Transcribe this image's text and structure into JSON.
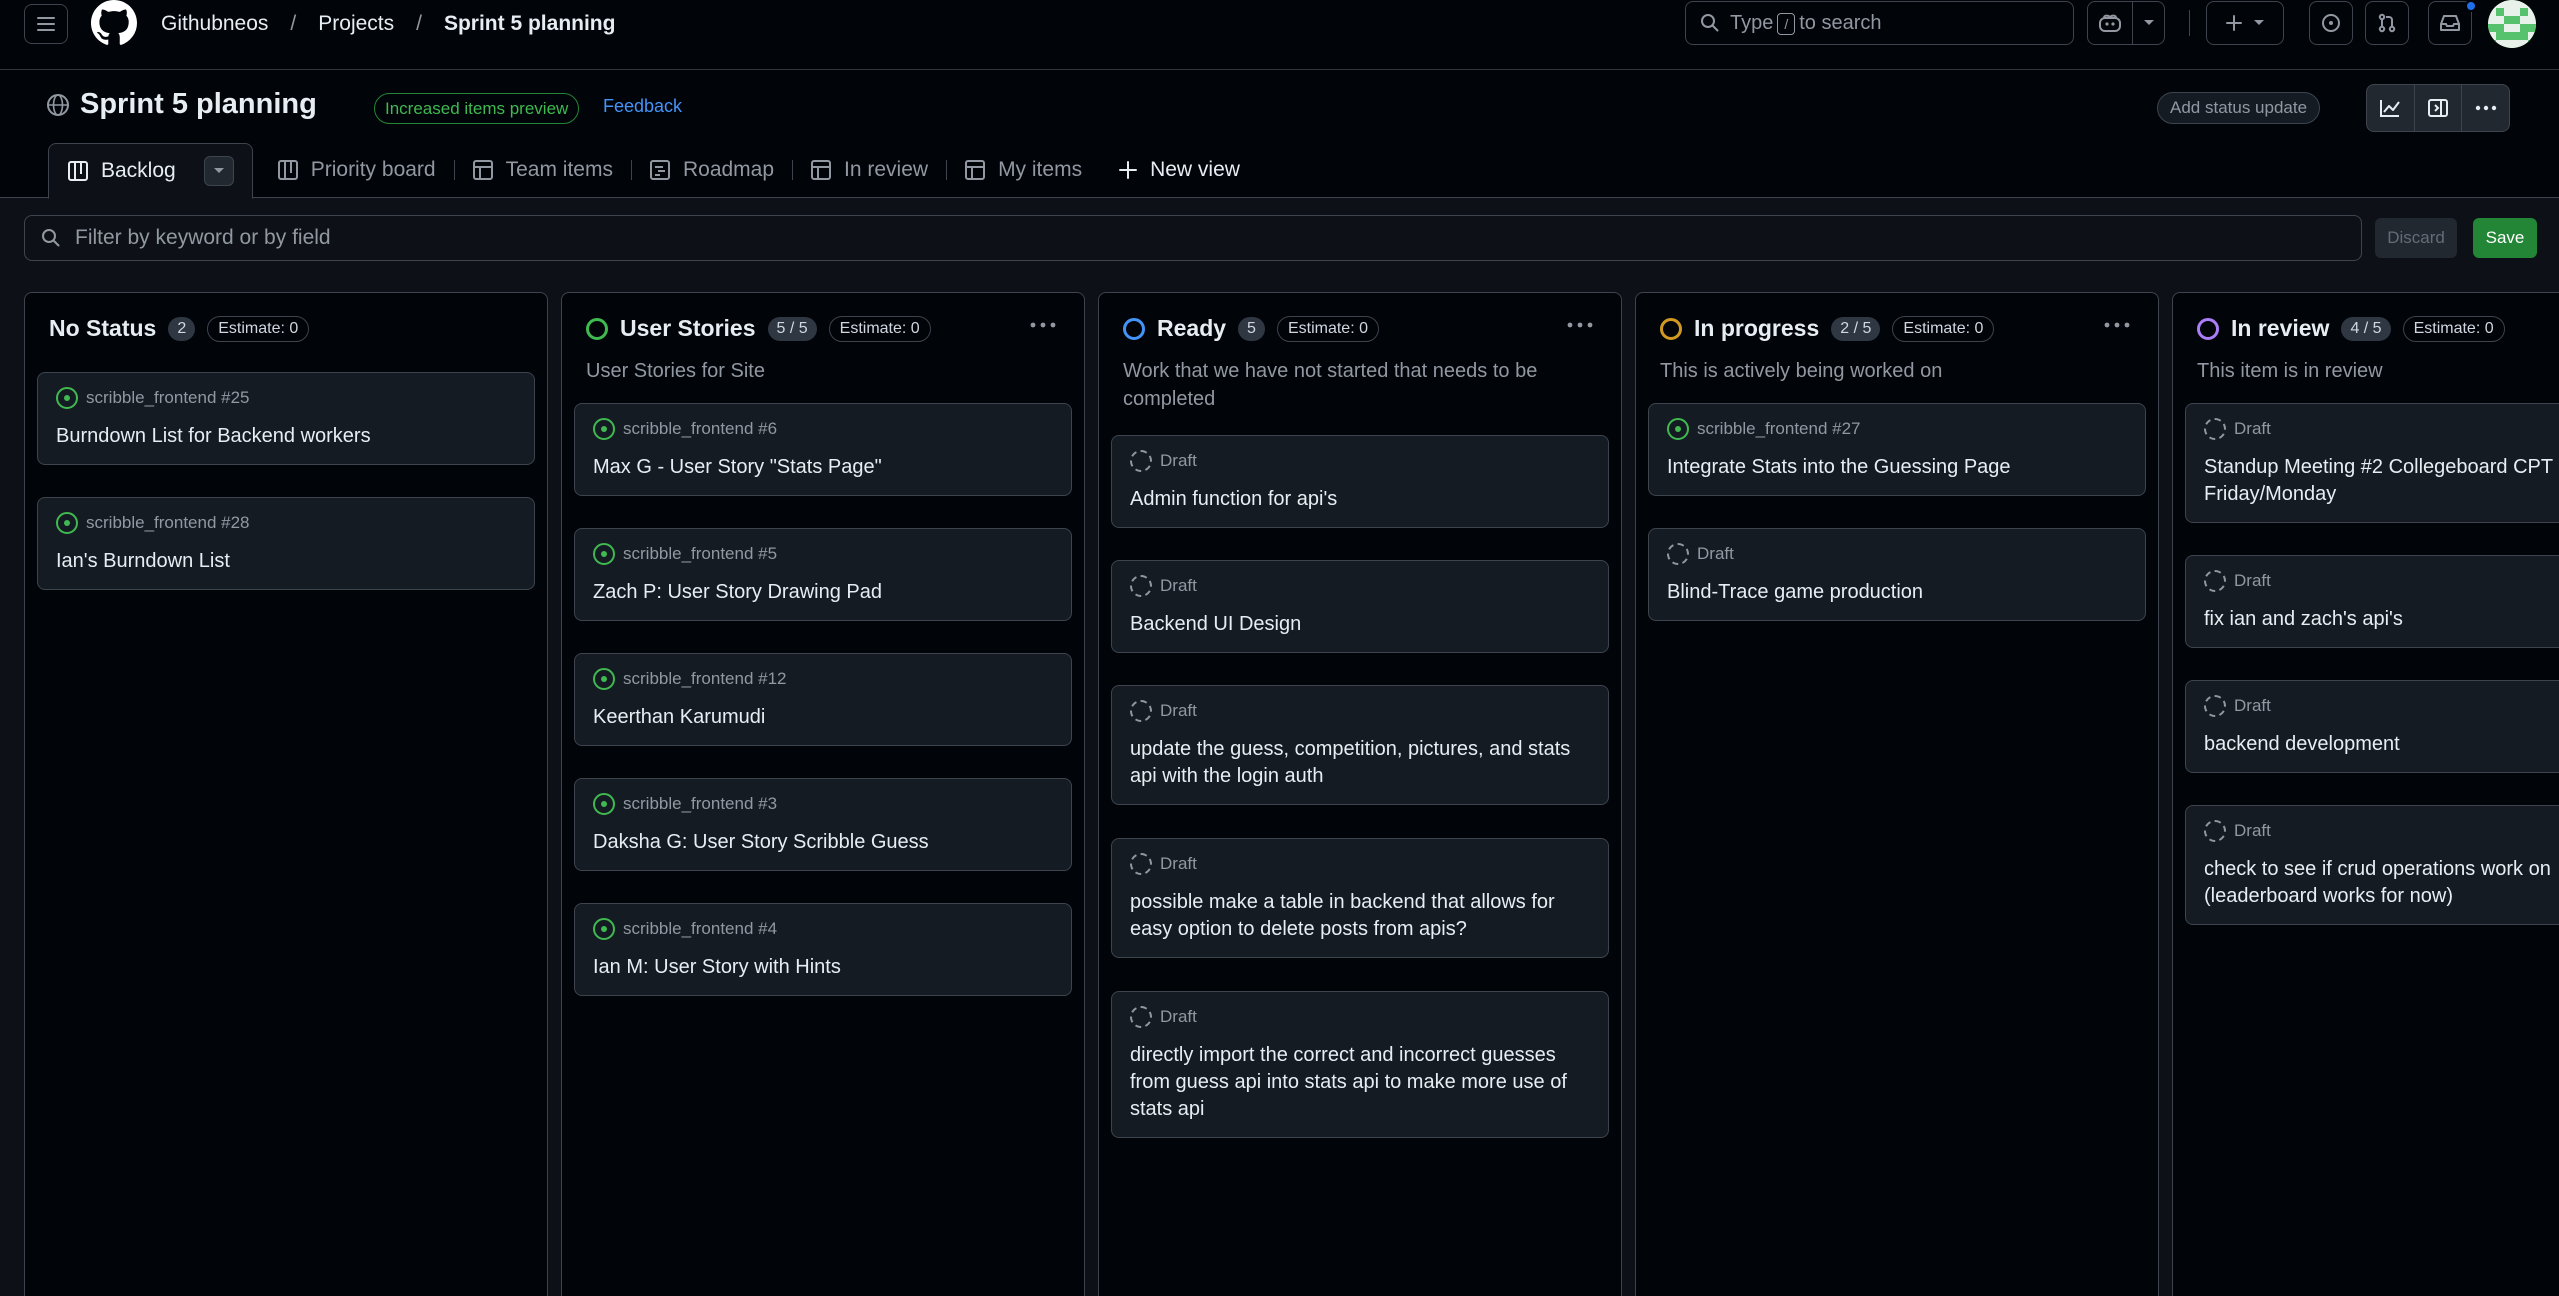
{
  "header": {
    "breadcrumbs": [
      "Githubneos",
      "Projects",
      "Sprint 5 planning"
    ],
    "search_placeholder_before": "Type",
    "search_key": "/",
    "search_placeholder_after": "to search"
  },
  "project": {
    "title": "Sprint 5 planning",
    "preview_badge": "Increased items preview",
    "feedback_link": "Feedback",
    "status_update_button": "Add status update"
  },
  "tabs": [
    {
      "label": "Backlog",
      "icon": "board-icon",
      "active": true
    },
    {
      "label": "Priority board",
      "icon": "board-icon"
    },
    {
      "label": "Team items",
      "icon": "table-icon"
    },
    {
      "label": "Roadmap",
      "icon": "roadmap-icon"
    },
    {
      "label": "In review",
      "icon": "table-icon"
    },
    {
      "label": "My items",
      "icon": "table-icon"
    },
    {
      "label": "New view",
      "icon": "plus-icon"
    }
  ],
  "filter": {
    "placeholder": "Filter by keyword or by field",
    "discard_label": "Discard",
    "save_label": "Save"
  },
  "colors": {
    "green": "#3fb950",
    "blue": "#4493f8",
    "orange": "#d29922",
    "purple": "#ab7df8",
    "gray": "#9198a1"
  },
  "columns": [
    {
      "name": "No Status",
      "count": "2",
      "estimate": "Estimate: 0",
      "description": "",
      "status_color": "",
      "has_menu": false,
      "cards": [
        {
          "type": "issue",
          "meta": "scribble_frontend #25",
          "title": "Burndown List for Backend workers"
        },
        {
          "type": "issue",
          "meta": "scribble_frontend #28",
          "title": "Ian's Burndown List"
        }
      ]
    },
    {
      "name": "User Stories",
      "count": "5 / 5",
      "estimate": "Estimate: 0",
      "description": "User Stories for Site",
      "status_color": "#3fb950",
      "has_menu": true,
      "cards": [
        {
          "type": "issue",
          "meta": "scribble_frontend #6",
          "title": "Max G - User Story \"Stats Page\""
        },
        {
          "type": "issue",
          "meta": "scribble_frontend #5",
          "title": "Zach P: User Story Drawing Pad"
        },
        {
          "type": "issue",
          "meta": "scribble_frontend #12",
          "title": "Keerthan Karumudi"
        },
        {
          "type": "issue",
          "meta": "scribble_frontend #3",
          "title": "Daksha G: User Story Scribble Guess"
        },
        {
          "type": "issue",
          "meta": "scribble_frontend #4",
          "title": "Ian M: User Story with Hints"
        }
      ]
    },
    {
      "name": "Ready",
      "count": "5",
      "estimate": "Estimate: 0",
      "description": "Work that we have not started that needs to be completed",
      "status_color": "#4493f8",
      "has_menu": true,
      "cards": [
        {
          "type": "draft",
          "meta": "Draft",
          "title": "Admin function for api's"
        },
        {
          "type": "draft",
          "meta": "Draft",
          "title": "Backend UI Design"
        },
        {
          "type": "draft",
          "meta": "Draft",
          "title": "update the guess, competition, pictures, and stats api with the login auth"
        },
        {
          "type": "draft",
          "meta": "Draft",
          "title": "possible make a table in backend that allows for easy option to delete posts from apis?"
        },
        {
          "type": "draft",
          "meta": "Draft",
          "title": "directly import the correct and incorrect guesses from guess api into stats api to make more use of stats api"
        }
      ]
    },
    {
      "name": "In progress",
      "count": "2 / 5",
      "estimate": "Estimate: 0",
      "description": "This is actively being worked on",
      "status_color": "#d29922",
      "has_menu": true,
      "cards": [
        {
          "type": "issue",
          "meta": "scribble_frontend #27",
          "title": "Integrate Stats into the Guessing Page"
        },
        {
          "type": "draft",
          "meta": "Draft",
          "title": "Blind-Trace game production"
        }
      ]
    },
    {
      "name": "In review",
      "count": "4 / 5",
      "estimate": "Estimate: 0",
      "description": "This item is in review",
      "status_color": "#ab7df8",
      "has_menu": false,
      "cards": [
        {
          "type": "draft",
          "meta": "Draft",
          "title": "Standup Meeting #2 Collegeboard CPT Friday/Monday"
        },
        {
          "type": "draft",
          "meta": "Draft",
          "title": "fix ian and zach's api's"
        },
        {
          "type": "draft",
          "meta": "Draft",
          "title": "backend development"
        },
        {
          "type": "draft",
          "meta": "Draft",
          "title": "check to see if crud operations work on (leaderboard works for now)"
        }
      ]
    }
  ]
}
